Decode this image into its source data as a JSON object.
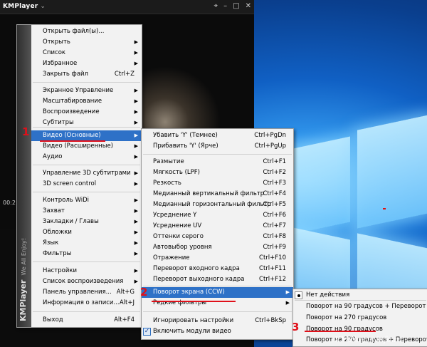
{
  "app": {
    "title": "KMPlayer",
    "time_display": "00:2"
  },
  "main_menu": {
    "items": [
      {
        "label": "Открыть файл(ы)...",
        "shortcut": "",
        "submenu": false
      },
      {
        "label": "Открыть",
        "shortcut": "",
        "submenu": true
      },
      {
        "label": "Список",
        "shortcut": "",
        "submenu": true
      },
      {
        "label": "Избранное",
        "shortcut": "",
        "submenu": true
      },
      {
        "label": "Закрыть файл",
        "shortcut": "Ctrl+Z",
        "submenu": false
      },
      {
        "label": "Экранное Управление",
        "shortcut": "",
        "submenu": true
      },
      {
        "label": "Масштабирование",
        "shortcut": "",
        "submenu": true
      },
      {
        "label": "Воспроизведение",
        "shortcut": "",
        "submenu": true
      },
      {
        "label": "Субтитры",
        "shortcut": "",
        "submenu": true
      },
      {
        "label": "Видео (Основные)",
        "shortcut": "",
        "submenu": true
      },
      {
        "label": "Видео (Расширенные)",
        "shortcut": "",
        "submenu": true
      },
      {
        "label": "Аудио",
        "shortcut": "",
        "submenu": true
      },
      {
        "label": "Управление 3D субтитрами",
        "shortcut": "",
        "submenu": true
      },
      {
        "label": "3D screen control",
        "shortcut": "",
        "submenu": true
      },
      {
        "label": "Контроль WiDi",
        "shortcut": "",
        "submenu": true
      },
      {
        "label": "Захват",
        "shortcut": "",
        "submenu": true
      },
      {
        "label": "Закладки / Главы",
        "shortcut": "",
        "submenu": true
      },
      {
        "label": "Обложки",
        "shortcut": "",
        "submenu": true
      },
      {
        "label": "Язык",
        "shortcut": "",
        "submenu": true
      },
      {
        "label": "Фильтры",
        "shortcut": "",
        "submenu": true
      },
      {
        "label": "Настройки",
        "shortcut": "",
        "submenu": true
      },
      {
        "label": "Список воспроизведения",
        "shortcut": "",
        "submenu": true
      },
      {
        "label": "Панель управления...",
        "shortcut": "Alt+G",
        "submenu": false
      },
      {
        "label": "Информация о записи...",
        "shortcut": "Alt+J",
        "submenu": false
      },
      {
        "label": "Выход",
        "shortcut": "Alt+F4",
        "submenu": false
      }
    ],
    "brand_vertical": "KMPlayer",
    "brand_tagline": "We All Enjoy!"
  },
  "video_menu": {
    "items": [
      {
        "label": "Убавить 'Y' (Темнее)",
        "shortcut": "Ctrl+PgDn"
      },
      {
        "label": "Прибавить 'Y' (Ярче)",
        "shortcut": "Ctrl+PgUp"
      },
      {
        "label": "Размытие",
        "shortcut": "Ctrl+F1"
      },
      {
        "label": "Мягкость (LPF)",
        "shortcut": "Ctrl+F2"
      },
      {
        "label": "Резкость",
        "shortcut": "Ctrl+F3"
      },
      {
        "label": "Медианный вертикальный фильтр",
        "shortcut": "Ctrl+F4"
      },
      {
        "label": "Медианный горизонтальный фильтр",
        "shortcut": "Ctrl+F5"
      },
      {
        "label": "Усреднение Y",
        "shortcut": "Ctrl+F6"
      },
      {
        "label": "Усреднение UV",
        "shortcut": "Ctrl+F7"
      },
      {
        "label": "Оттенки серого",
        "shortcut": "Ctrl+F8"
      },
      {
        "label": "Автовыбор уровня",
        "shortcut": "Ctrl+F9"
      },
      {
        "label": "Отражение",
        "shortcut": "Ctrl+F10"
      },
      {
        "label": "Переворот входного кадра",
        "shortcut": "Ctrl+F11"
      },
      {
        "label": "Переворот выходного кадра",
        "shortcut": "Ctrl+F12"
      },
      {
        "label": "Поворот экрана (CCW)",
        "shortcut": ""
      },
      {
        "label": "Редкие фильтры",
        "shortcut": ""
      },
      {
        "label": "Игнорировать настройки",
        "shortcut": "Ctrl+BkSp"
      },
      {
        "label": "Включить модули видео",
        "shortcut": ""
      }
    ]
  },
  "rotate_menu": {
    "items": [
      {
        "label": "Нет действия"
      },
      {
        "label": "Поворот на 90 градусов + Переворот"
      },
      {
        "label": "Поворот на 270 градусов"
      },
      {
        "label": "Поворот на 90 градусов"
      },
      {
        "label": "Поворот на 270 градусов + Переворот"
      }
    ]
  },
  "annotations": {
    "step1": "1",
    "step2": "2",
    "step3": "3"
  },
  "watermark": "KMPlayer-info.ru",
  "colors": {
    "highlight": "#2e71c7",
    "annotation_red": "#e0101a",
    "menu_bg": "#f2f2f2"
  }
}
